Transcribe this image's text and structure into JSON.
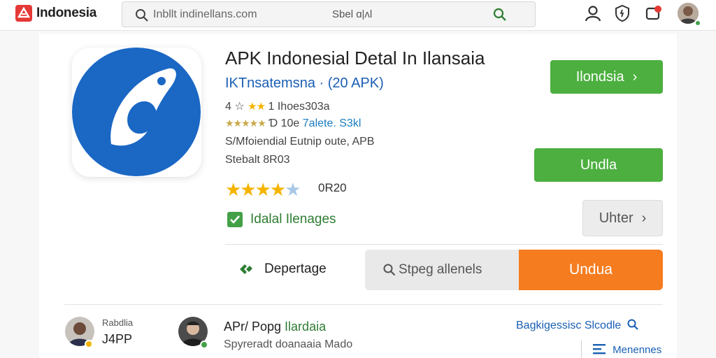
{
  "header": {
    "brand": "Indonesia",
    "search_placeholder": "Inbllt indinellans.com",
    "search_side": "Sbel ɑ|ᴧl"
  },
  "app": {
    "title": "APK Indonesial Detal In Ilansaia",
    "subtitle": "IKTnsatemsna · (20 APK)",
    "rating_line": {
      "prefix": "4 ☆",
      "stars": "★★",
      "text": "1 Ihoes303a"
    },
    "review_line": {
      "stars": "★★★★★",
      "text": "Ɗ 10e",
      "link": "7alete. S3kl"
    },
    "version_line": "S/Mfoiendial Eutnip oute, APB",
    "size_line": "Stebalt 8R03",
    "rating_value": "0R20",
    "rating_fraction": 0.9,
    "check_label": "Idalal Ilenages"
  },
  "buttons": {
    "primary": "Ilondsia",
    "download": "Undla",
    "other": "Uhter",
    "dep": "Depertage",
    "search2": "Stpeg allenels",
    "undua": "Undua"
  },
  "bottom": {
    "user1_small": "Rabdlia",
    "user1_big": "J4PP",
    "user2_title_prefix": "APr/ Popg ",
    "user2_title_green": "Ilardaia",
    "user2_desc": "Spyreradt doanaaia Mado",
    "right_link": "Bagkigessisc Slcodle",
    "right_link2": "Menennes"
  },
  "colors": {
    "accent_green": "#4caf3f",
    "accent_orange": "#f57c1f",
    "link_blue": "#1a5fb4",
    "app_blue": "#1a67c4"
  }
}
